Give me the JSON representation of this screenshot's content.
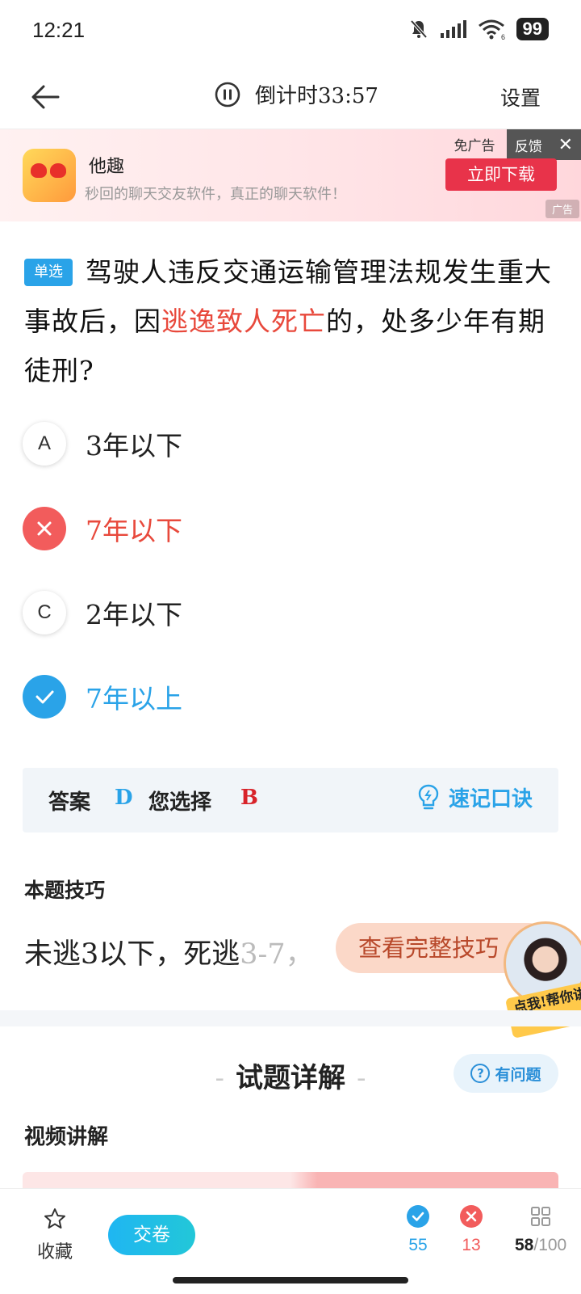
{
  "status_bar": {
    "time": "12:21",
    "battery": "99",
    "wifi_label": "6"
  },
  "nav": {
    "back_label": "←",
    "timer": "倒计时33:57",
    "settings": "设置"
  },
  "ad": {
    "app_name": "他趣",
    "description": "秒回的聊天交友软件，真正的聊天软件！",
    "no_ads": "免广告",
    "feedback": "反馈",
    "download": "立即下载",
    "ad_tag": "广告"
  },
  "question": {
    "type_tag": "单选",
    "text_before": "驾驶人违反交通运输管理法规发生重大事故后，因",
    "text_highlight": "逃逸致人死亡",
    "text_after": "的，处多少年有期徒刑?"
  },
  "options": [
    {
      "letter": "A",
      "text": "3年以下",
      "state": "normal"
    },
    {
      "letter": "B",
      "text": "7年以下",
      "state": "wrong"
    },
    {
      "letter": "C",
      "text": "2年以下",
      "state": "normal"
    },
    {
      "letter": "D",
      "text": "7年以上",
      "state": "correct"
    }
  ],
  "answer": {
    "label": "答案",
    "correct": "D",
    "yours_label": "您选择",
    "yours": "B",
    "quick_tip": "速记口诀"
  },
  "tips": {
    "title": "本题技巧",
    "text": "未逃3以下，死逃",
    "text_faded": "3-7，",
    "button": "查看完整技巧",
    "teacher_badge": "点我!帮你讲"
  },
  "detail": {
    "title": "试题详解",
    "problem_button": "有问题",
    "video_title": "视频讲解"
  },
  "bottom_bar": {
    "favorite": "收藏",
    "submit": "交卷",
    "correct_count": "55",
    "wrong_count": "13",
    "progress_current": "58",
    "progress_total": "/100"
  },
  "colors": {
    "accent": "#2aa3e8",
    "error": "#e8493c",
    "ad_button": "#e8334a"
  }
}
